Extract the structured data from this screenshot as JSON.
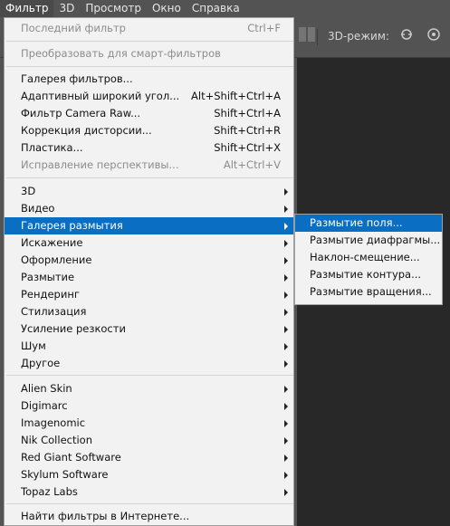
{
  "menubar": {
    "items": [
      "Фильтр",
      "3D",
      "Просмотр",
      "Окно",
      "Справка"
    ]
  },
  "optionsbar": {
    "mode_label": "3D-режим:",
    "icons": [
      "align-icon",
      "3d-rotate-icon",
      "3d-orbit-icon"
    ]
  },
  "filter_menu": {
    "last_filter": {
      "label": "Последний фильтр",
      "shortcut": "Ctrl+F"
    },
    "convert_smart": {
      "label": "Преобразовать для смарт-фильтров"
    },
    "gallery": {
      "label": "Галерея фильтров..."
    },
    "adaptive_wide": {
      "label": "Адаптивный широкий угол...",
      "shortcut": "Alt+Shift+Ctrl+A"
    },
    "camera_raw": {
      "label": "Фильтр Camera Raw...",
      "shortcut": "Shift+Ctrl+A"
    },
    "lens_correction": {
      "label": "Коррекция дисторсии...",
      "shortcut": "Shift+Ctrl+R"
    },
    "liquify": {
      "label": "Пластика...",
      "shortcut": "Shift+Ctrl+X"
    },
    "vanishing_point": {
      "label": "Исправление перспективы...",
      "shortcut": "Alt+Ctrl+V"
    },
    "submenus": [
      "3D",
      "Видео",
      "Галерея размытия",
      "Искажение",
      "Оформление",
      "Размытие",
      "Рендеринг",
      "Стилизация",
      "Усиление резкости",
      "Шум",
      "Другое"
    ],
    "plugins": [
      "Alien Skin",
      "Digimarc",
      "Imagenomic",
      "Nik Collection",
      "Red Giant Software",
      "Skylum Software",
      "Topaz Labs"
    ],
    "browse_online": {
      "label": "Найти фильтры в Интернете..."
    }
  },
  "blur_gallery_submenu": {
    "items": [
      "Размытие поля...",
      "Размытие диафрагмы...",
      "Наклон-смещение...",
      "Размытие контура...",
      "Размытие вращения..."
    ]
  },
  "colors": {
    "highlight": "#0a6fc2",
    "menu_bg": "#f2f2f2",
    "app_bg": "#535353"
  }
}
